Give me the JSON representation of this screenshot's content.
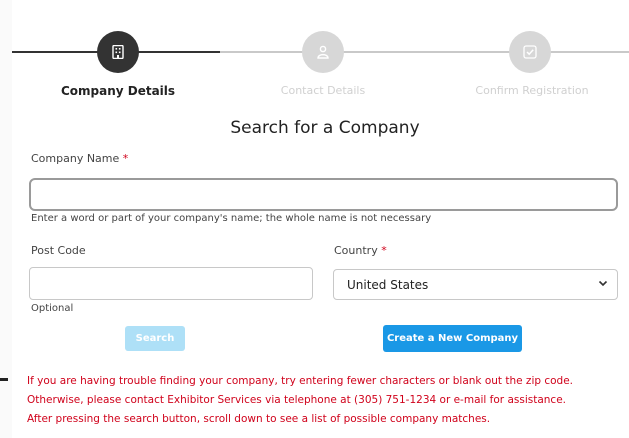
{
  "stepper": {
    "steps": [
      {
        "label": "Company Details",
        "state": "active",
        "icon": "building-icon"
      },
      {
        "label": "Contact Details",
        "state": "inactive",
        "icon": "person-icon"
      },
      {
        "label": "Confirm Registration",
        "state": "inactive",
        "icon": "check-icon"
      }
    ]
  },
  "heading": "Search for a Company",
  "company_name": {
    "label": "Company Name",
    "required_mark": "*",
    "value": "",
    "help": "Enter a word or part of your company's name; the whole name is not necessary"
  },
  "post_code": {
    "label": "Post Code",
    "value": "",
    "help": "Optional"
  },
  "country": {
    "label": "Country",
    "required_mark": "*",
    "selected": "United States"
  },
  "buttons": {
    "search": "Search",
    "create_company": "Create a New Company"
  },
  "notice": {
    "line1": "If you are having trouble finding your company, try entering fewer characters or blank out the zip code.",
    "line2": "Otherwise, please contact Exhibitor Services via telephone at (305) 751-1234 or e-mail for assistance.",
    "line3": "After pressing the search button, scroll down to see a list of possible company matches."
  },
  "colors": {
    "accent": "#1a98e6",
    "accent_disabled": "#aee0f7",
    "error": "#d0021b",
    "step_active": "#333333",
    "step_inactive": "#d7d7d7"
  }
}
